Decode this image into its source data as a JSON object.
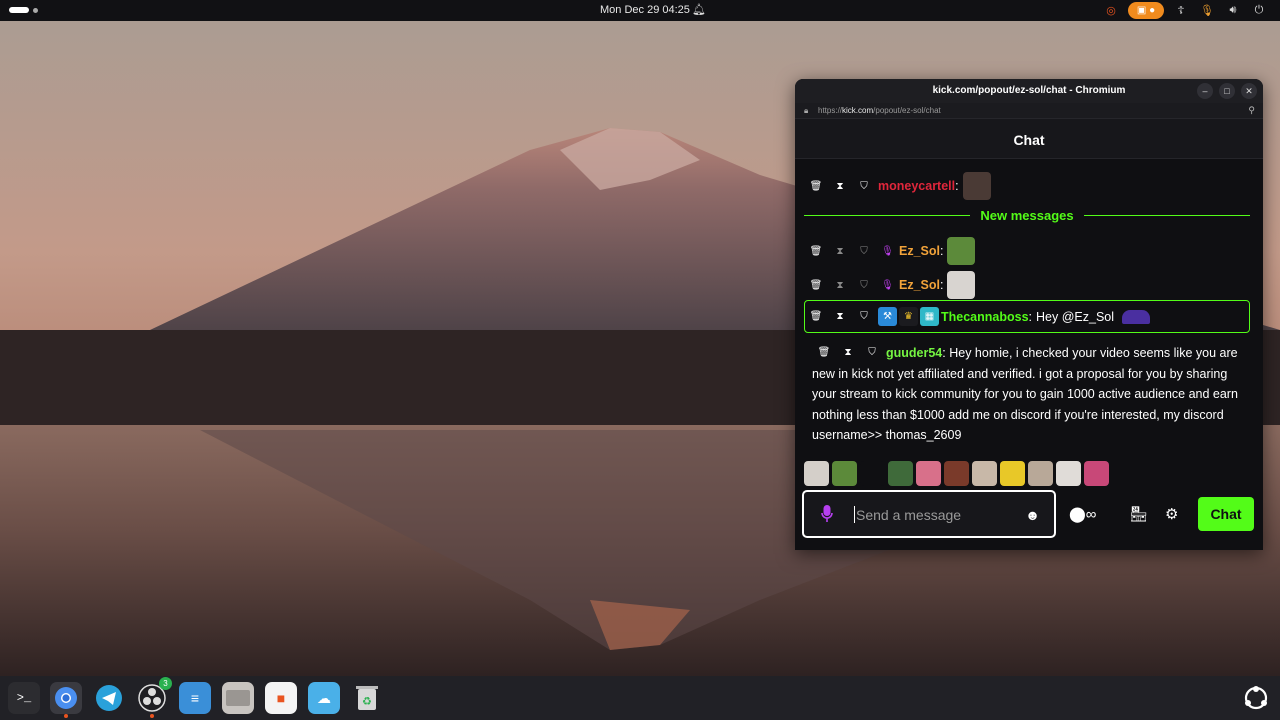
{
  "topbar": {
    "datetime": "Mon Dec 29  04:25",
    "icons": [
      "activities-icon",
      "bell-icon",
      "ubuntu-icon",
      "screen-record-icon",
      "accessibility-icon",
      "mic-icon",
      "volume-icon",
      "power-icon"
    ]
  },
  "browser": {
    "window_title": "kick.com/popout/ez-sol/chat - Chromium",
    "url_prefix": "https://",
    "url_domain": "kick.com",
    "url_path": "/popout/ez-sol/chat",
    "zoom_icon": "magnifier-icon"
  },
  "chat": {
    "header": "Chat",
    "new_messages_label": "New messages",
    "messages": [
      {
        "username": "moneycartell",
        "separator": ":",
        "color": "#e0263b"
      },
      {
        "username": "Ez_Sol",
        "separator": ":",
        "color": "#f2a33a"
      },
      {
        "username": "Ez_Sol",
        "separator": ":",
        "color": "#f2a33a"
      },
      {
        "username": "Thecannaboss",
        "separator": ":",
        "text": "Hey @Ez_Sol",
        "color": "#53fc18"
      },
      {
        "username": "guuder54",
        "separator": ":",
        "text": "Hey homie, i checked your video seems like you are new in kick not yet affiliated and verified. i got a proposal for you by sharing your stream to kick community for you to gain 1000 active audience and earn nothing less than $1000 add me on discord if you're interested, my discord username>> thomas_2609",
        "color": "#75f542"
      }
    ],
    "input": {
      "placeholder": "Send a message"
    },
    "send_button": "Chat",
    "accent_color": "#53fc18"
  },
  "dock": {
    "apps": [
      "terminal-icon",
      "chromium-icon",
      "telegram-icon",
      "obs-icon",
      "mixer-icon",
      "files-icon",
      "app-center-icon",
      "weather-icon",
      "trash-icon"
    ],
    "obs_badge": "3"
  }
}
